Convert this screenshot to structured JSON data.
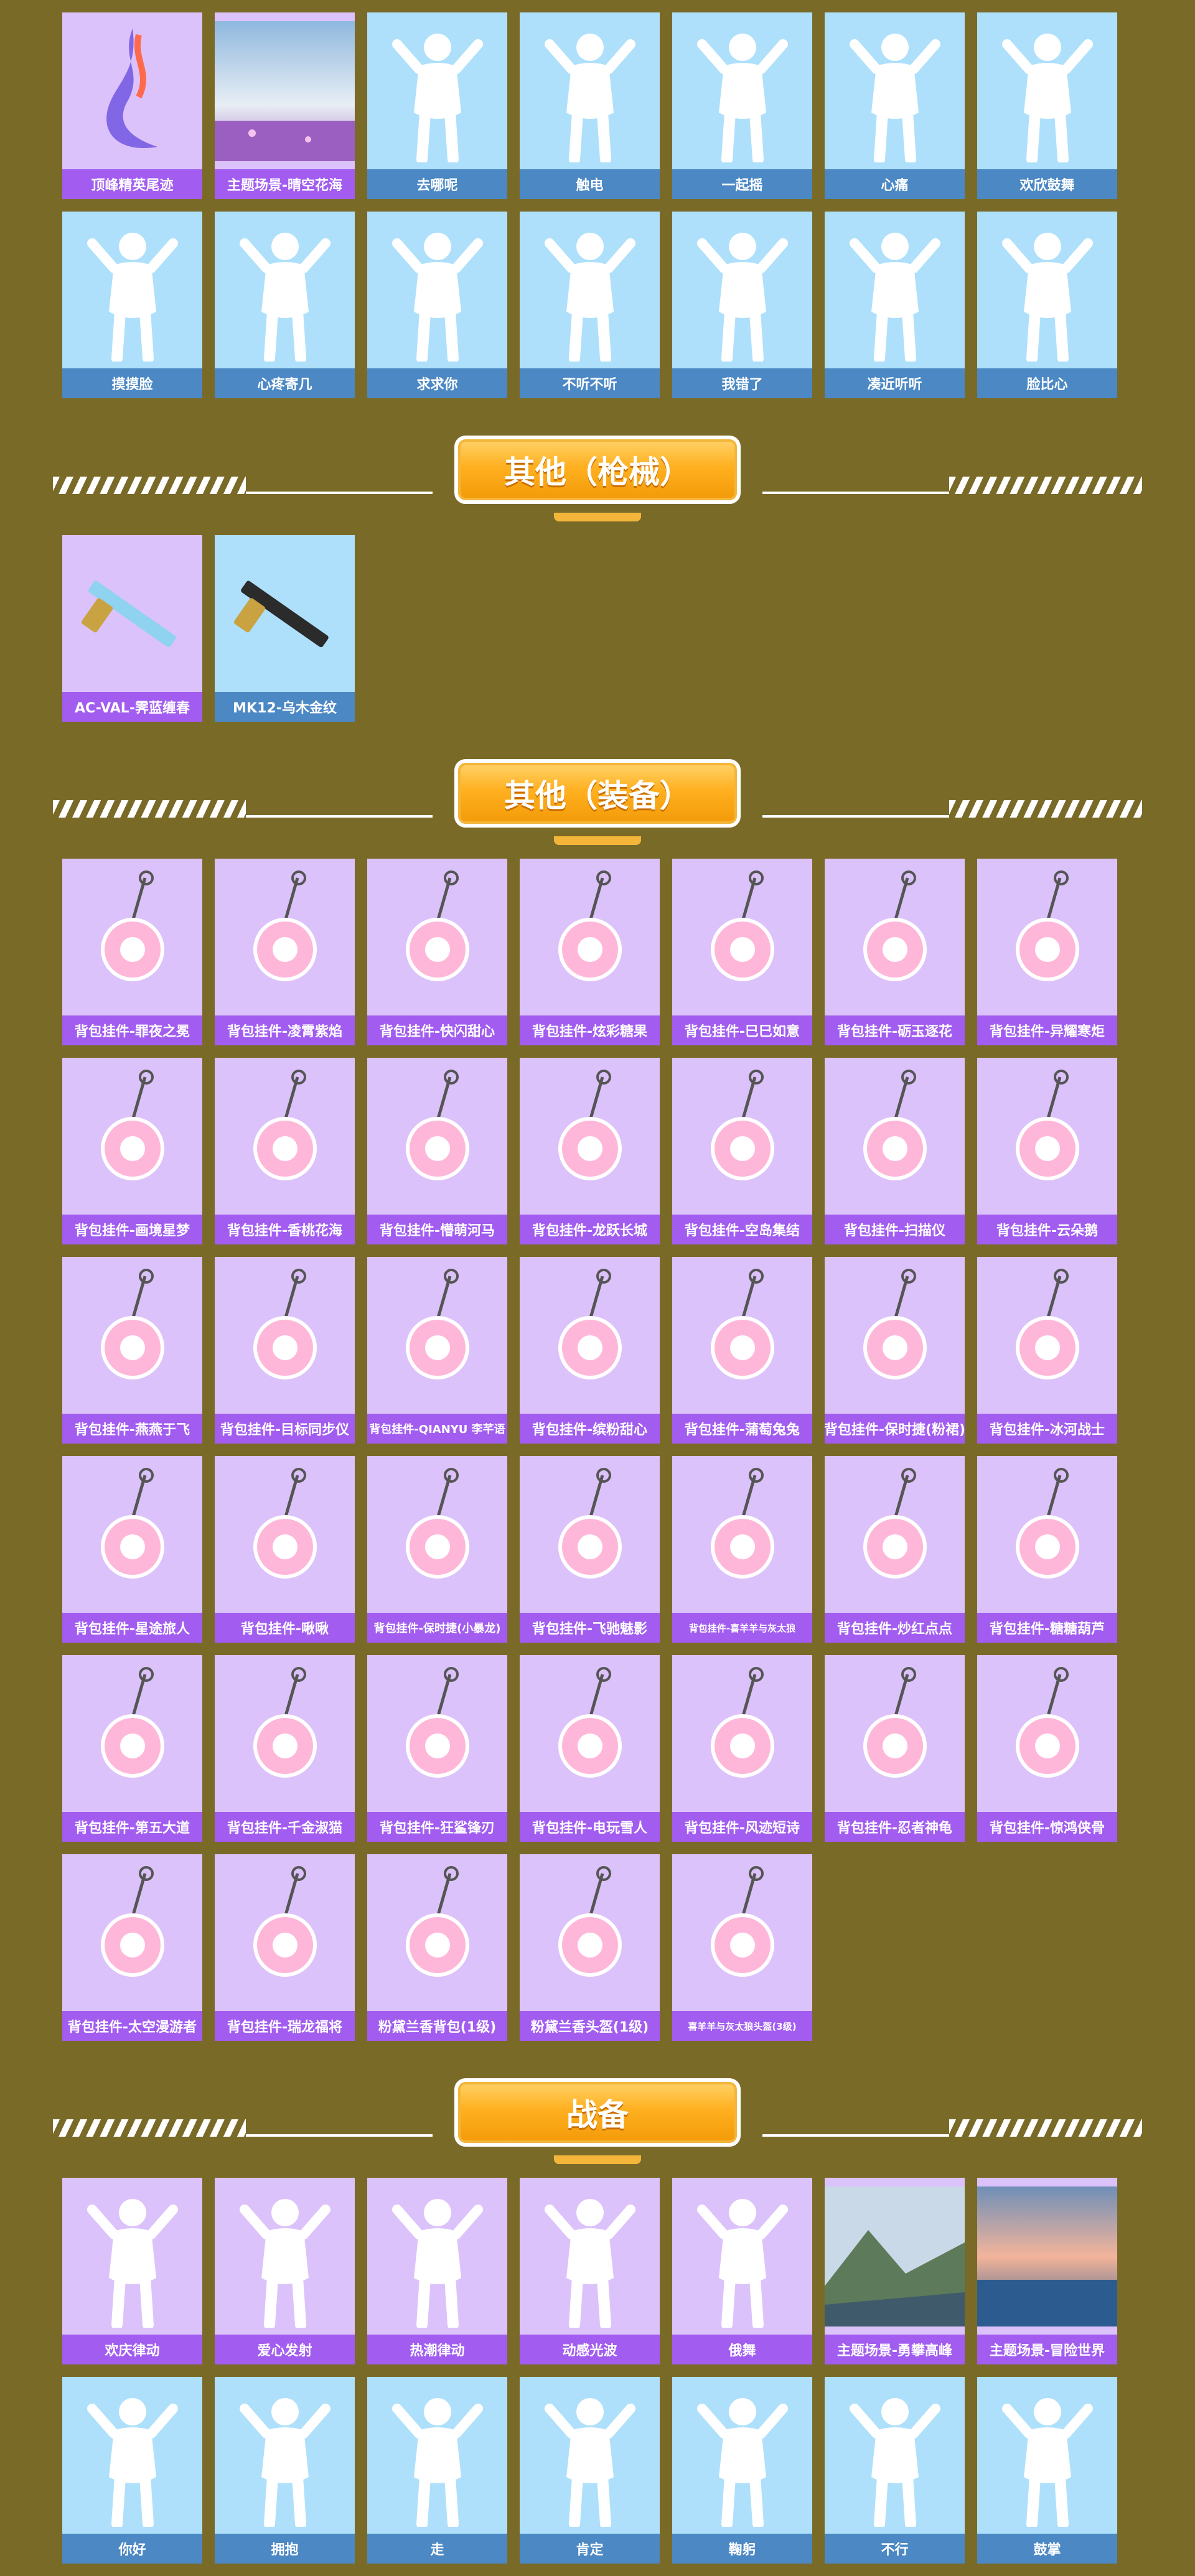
{
  "sections": {
    "emotes_top": {
      "row1": [
        {
          "label": "顶峰精英尾迹",
          "color": "purple",
          "icon": "flame-trail-icon"
        },
        {
          "label": "主题场景-晴空花海",
          "color": "purple",
          "icon": "flower-field-scene"
        },
        {
          "label": "去哪呢",
          "color": "blue",
          "icon": "figure-silhouette"
        },
        {
          "label": "触电",
          "color": "blue",
          "icon": "figure-silhouette"
        },
        {
          "label": "一起摇",
          "color": "blue",
          "icon": "figure-silhouette"
        },
        {
          "label": "心痛",
          "color": "blue",
          "icon": "figure-silhouette"
        },
        {
          "label": "欢欣鼓舞",
          "color": "blue",
          "icon": "figure-silhouette"
        }
      ],
      "row2": [
        {
          "label": "摸摸脸",
          "color": "blue",
          "icon": "figure-silhouette"
        },
        {
          "label": "心疼寄几",
          "color": "blue",
          "icon": "figure-silhouette"
        },
        {
          "label": "求求你",
          "color": "blue",
          "icon": "figure-silhouette"
        },
        {
          "label": "不听不听",
          "color": "blue",
          "icon": "figure-silhouette"
        },
        {
          "label": "我错了",
          "color": "blue",
          "icon": "figure-silhouette"
        },
        {
          "label": "凑近听听",
          "color": "blue",
          "icon": "figure-silhouette"
        },
        {
          "label": "脸比心",
          "color": "blue",
          "icon": "figure-silhouette"
        }
      ]
    },
    "guns": {
      "title": "其他（枪械）",
      "items": [
        {
          "label": "AC-VAL-霁蓝缠春",
          "color": "purple",
          "icon": "rifle-icon"
        },
        {
          "label": "MK12-乌木金纹",
          "color": "blue",
          "icon": "rifle-icon"
        }
      ]
    },
    "equipment": {
      "title": "其他（装备）",
      "rows": [
        [
          {
            "label": "背包挂件-罪夜之冕",
            "color": "purple"
          },
          {
            "label": "背包挂件-凌霄紫焰",
            "color": "purple"
          },
          {
            "label": "背包挂件-快闪甜心",
            "color": "purple"
          },
          {
            "label": "背包挂件-炫彩糖果",
            "color": "purple"
          },
          {
            "label": "背包挂件-巳巳如意",
            "color": "purple"
          },
          {
            "label": "背包挂件-砺玉逐花",
            "color": "purple"
          },
          {
            "label": "背包挂件-异耀寒炬",
            "color": "purple"
          }
        ],
        [
          {
            "label": "背包挂件-画境星梦",
            "color": "purple"
          },
          {
            "label": "背包挂件-香桃花海",
            "color": "purple"
          },
          {
            "label": "背包挂件-懵萌河马",
            "color": "purple"
          },
          {
            "label": "背包挂件-龙跃长城",
            "color": "purple"
          },
          {
            "label": "背包挂件-空岛集结",
            "color": "purple"
          },
          {
            "label": "背包挂件-扫描仪",
            "color": "purple"
          },
          {
            "label": "背包挂件-云朵鹅",
            "color": "purple"
          }
        ],
        [
          {
            "label": "背包挂件-燕燕于飞",
            "color": "purple"
          },
          {
            "label": "背包挂件-目标同步仪",
            "color": "purple"
          },
          {
            "label": "背包挂件-QIANYU 李芊语",
            "color": "purple",
            "small": true
          },
          {
            "label": "背包挂件-缤粉甜心",
            "color": "purple"
          },
          {
            "label": "背包挂件-蒲萄兔兔",
            "color": "purple"
          },
          {
            "label": "背包挂件-保时捷(粉裙)",
            "color": "purple"
          },
          {
            "label": "背包挂件-冰河战士",
            "color": "purple"
          }
        ],
        [
          {
            "label": "背包挂件-星途旅人",
            "color": "purple"
          },
          {
            "label": "背包挂件-啾啾",
            "color": "purple"
          },
          {
            "label": "背包挂件-保时捷(小暴龙)",
            "color": "purple",
            "small": true
          },
          {
            "label": "背包挂件-飞驰魅影",
            "color": "purple"
          },
          {
            "label": "背包挂件-喜羊羊与灰太狼",
            "color": "purple",
            "xsmall": true
          },
          {
            "label": "背包挂件-炒红点点",
            "color": "purple"
          },
          {
            "label": "背包挂件-糖糖葫芦",
            "color": "purple"
          }
        ],
        [
          {
            "label": "背包挂件-第五大道",
            "color": "purple"
          },
          {
            "label": "背包挂件-千金淑猫",
            "color": "purple"
          },
          {
            "label": "背包挂件-狂鲨锋刃",
            "color": "purple"
          },
          {
            "label": "背包挂件-电玩雪人",
            "color": "purple"
          },
          {
            "label": "背包挂件-风迹短诗",
            "color": "purple"
          },
          {
            "label": "背包挂件-忍者神龟",
            "color": "purple"
          },
          {
            "label": "背包挂件-惊鸿侠骨",
            "color": "purple"
          }
        ],
        [
          {
            "label": "背包挂件-太空漫游者",
            "color": "purple"
          },
          {
            "label": "背包挂件-瑞龙福将",
            "color": "purple"
          },
          {
            "label": "粉黛兰香背包(1级)",
            "color": "purple"
          },
          {
            "label": "粉黛兰香头盔(1级)",
            "color": "purple"
          },
          {
            "label": "喜羊羊与灰太狼头盔(3级)",
            "color": "purple",
            "xsmall": true
          }
        ]
      ]
    },
    "battle": {
      "title": "战备",
      "row1": [
        {
          "label": "欢庆律动",
          "color": "purple",
          "icon": "dance-figure"
        },
        {
          "label": "爱心发射",
          "color": "purple",
          "icon": "dance-figure"
        },
        {
          "label": "热潮律动",
          "color": "purple",
          "icon": "dance-figure"
        },
        {
          "label": "动感光波",
          "color": "purple",
          "icon": "dance-figure"
        },
        {
          "label": "俄舞",
          "color": "purple",
          "icon": "dance-figure"
        },
        {
          "label": "主题场景-勇攀高峰",
          "color": "purple",
          "icon": "mountain-scene"
        },
        {
          "label": "主题场景-冒险世界",
          "color": "purple",
          "icon": "sea-scene"
        }
      ],
      "row2": [
        {
          "label": "你好",
          "color": "blue",
          "icon": "gesture-figure"
        },
        {
          "label": "拥抱",
          "color": "blue",
          "icon": "gesture-figure"
        },
        {
          "label": "走",
          "color": "blue",
          "icon": "gesture-figure"
        },
        {
          "label": "肯定",
          "color": "blue",
          "icon": "gesture-figure"
        },
        {
          "label": "鞠躬",
          "color": "blue",
          "icon": "gesture-figure"
        },
        {
          "label": "不行",
          "color": "blue",
          "icon": "gesture-figure"
        },
        {
          "label": "鼓掌",
          "color": "blue",
          "icon": "gesture-figure"
        }
      ]
    }
  }
}
